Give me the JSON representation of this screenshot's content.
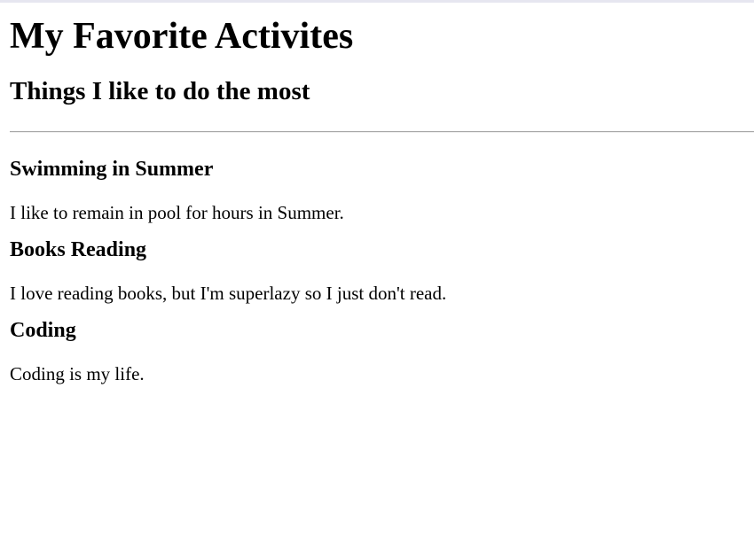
{
  "page": {
    "title": "My Favorite Activites",
    "subtitle": "Things I like to do the most"
  },
  "activities": [
    {
      "title": "Swimming in Summer",
      "description": "I like to remain in pool for hours in Summer."
    },
    {
      "title": "Books Reading",
      "description": "I love reading books, but I'm superlazy so I just don't read."
    },
    {
      "title": "Coding",
      "description": "Coding is my life."
    }
  ]
}
